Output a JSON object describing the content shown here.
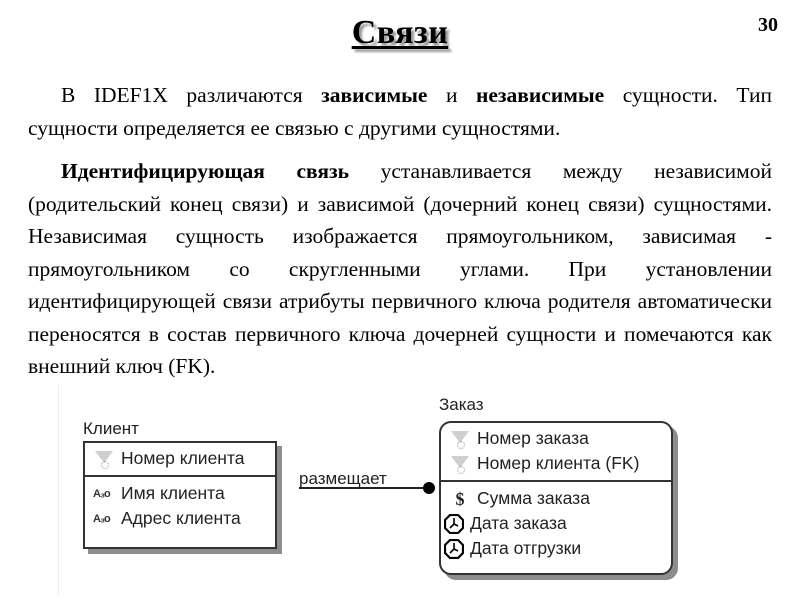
{
  "slide": {
    "title": "Связи",
    "page_number": "30"
  },
  "paragraphs": [
    {
      "parts": [
        {
          "text": "В IDEF1X различаются ",
          "bold": false
        },
        {
          "text": "зависимые",
          "bold": true
        },
        {
          "text": " и ",
          "bold": false
        },
        {
          "text": "независимые",
          "bold": true
        },
        {
          "text": " сущности. Тип сущности определяется ее связью с другими сущностями.",
          "bold": false
        }
      ]
    },
    {
      "parts": [
        {
          "text": "Идентифицирующая связь",
          "bold": true
        },
        {
          "text": " устанавливается между независимой (родительский конец связи) и зависимой (дочерний конец связи) сущностями. Независимая сущность изображается прямоугольником, зависимая - прямоугольником со скругленными углами. При установлении идентифицирующей связи атрибуты первичного ключа родителя автоматически переносятся в состав первичного ключа дочерней сущности и помечаются как внешний ключ (FK).",
          "bold": false
        }
      ]
    }
  ],
  "diagram": {
    "relationship_label": "размещает",
    "entities": [
      {
        "name": "Клиент",
        "kind": "independent",
        "key_attributes": [
          {
            "icon": "key-icon",
            "label": "Номер клиента"
          }
        ],
        "attributes": [
          {
            "icon": "text-type-icon",
            "icon_text": "A₃o",
            "label": "Имя клиента"
          },
          {
            "icon": "text-type-icon",
            "icon_text": "A₃o",
            "label": "Адрес клиента"
          }
        ]
      },
      {
        "name": "Заказ",
        "kind": "dependent",
        "key_attributes": [
          {
            "icon": "key-icon",
            "label": "Номер заказа"
          },
          {
            "icon": "key-icon",
            "label": "Номер клиента (FK)"
          }
        ],
        "attributes": [
          {
            "icon": "money-icon",
            "icon_text": "$",
            "label": "Сумма заказа"
          },
          {
            "icon": "clock-icon",
            "label": "Дата заказа"
          },
          {
            "icon": "clock-icon",
            "label": "Дата отгрузки"
          }
        ]
      }
    ]
  }
}
